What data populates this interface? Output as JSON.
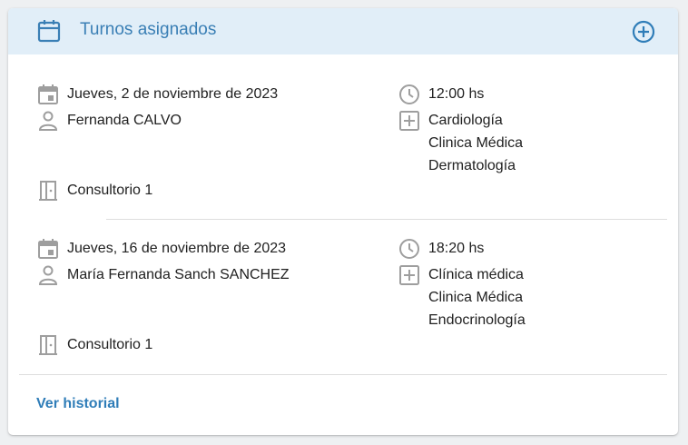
{
  "header": {
    "title": "Turnos asignados",
    "icon": "calendar-icon",
    "add_icon": "add-circle-icon",
    "accent_color": "#3a7fb5"
  },
  "appointments": [
    {
      "date": "Jueves, 2 de noviembre de 2023",
      "time": "12:00 hs",
      "professional": "Fernanda CALVO",
      "specialties": [
        "Cardiología",
        "Clinica Médica",
        "Dermatología"
      ],
      "room": "Consultorio 1"
    },
    {
      "date": "Jueves, 16 de noviembre de 2023",
      "time": "18:20 hs",
      "professional": "María Fernanda Sanch SANCHEZ",
      "specialties": [
        "Clínica médica",
        "Clinica Médica",
        "Endocrinología"
      ],
      "room": "Consultorio 1"
    }
  ],
  "footer": {
    "history_link": "Ver historial"
  }
}
